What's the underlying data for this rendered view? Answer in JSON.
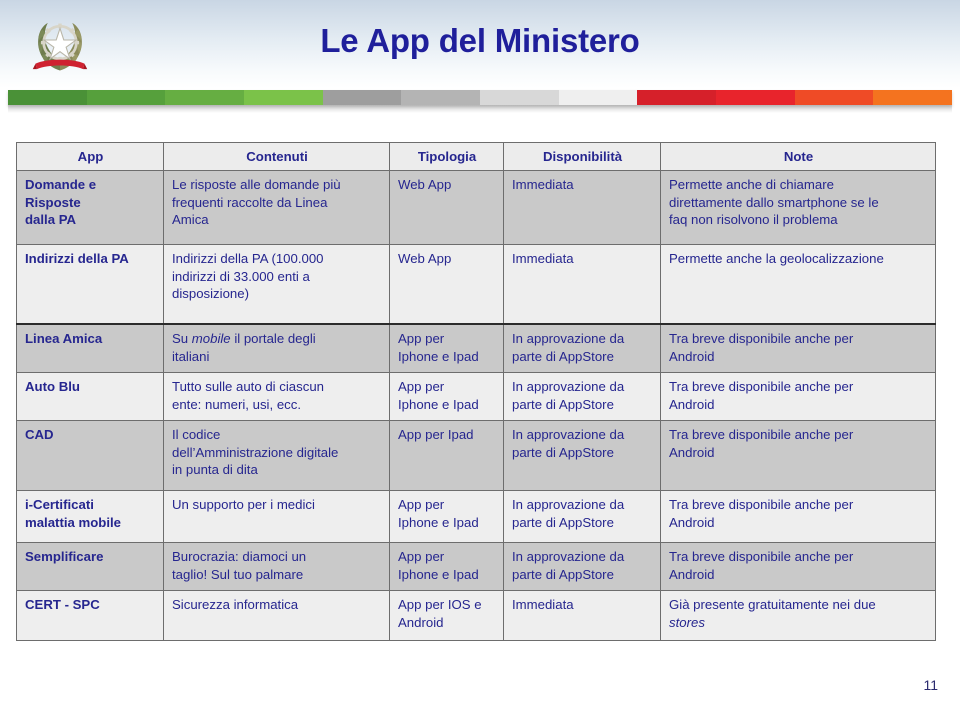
{
  "header": {
    "title": "Le App del Ministero",
    "emblem_name": "emblem-of-italy",
    "title_color": "#1f1f9b",
    "tricolor": {
      "segments": [
        "#4a9137",
        "#56a03c",
        "#66ae42",
        "#7bc249",
        "#9e9e9e",
        "#b4b4b4",
        "#d8d8d8",
        "#efefef",
        "#d6202a",
        "#e8242c",
        "#ef4b26",
        "#f4731f"
      ]
    }
  },
  "table": {
    "columns": [
      "App",
      "Contenuti",
      "Tipologia",
      "Disponibilità",
      "Note"
    ],
    "rows": [
      {
        "app": "Domande e Risposte dalla PA",
        "app_lines": [
          "Domande e",
          "Risposte",
          "dalla PA"
        ],
        "contenuti": "Le risposte alle domande più frequenti raccolte da Linea Amica",
        "contenuti_lines": [
          "Le risposte alle domande più",
          "frequenti raccolte da Linea",
          "Amica"
        ],
        "tipologia": "Web App",
        "tipologia_lines": [
          "Web App"
        ],
        "disponibilita": "Immediata",
        "disponibilita_lines": [
          "Immediata"
        ],
        "note": "Permette anche di chiamare direttamente dallo smartphone se le faq non risolvono il problema",
        "note_lines": [
          "Permette anche di chiamare",
          "direttamente dallo smartphone se le",
          "faq non risolvono il problema"
        ]
      },
      {
        "app": "Indirizzi della PA",
        "app_lines": [
          "Indirizzi della PA"
        ],
        "contenuti": "Indirizzi della PA (100.000 indirizzi di 33.000 enti a disposizione)",
        "contenuti_lines": [
          "Indirizzi della PA (100.000",
          "indirizzi di 33.000 enti a",
          "disposizione)"
        ],
        "tipologia": "Web App",
        "tipologia_lines": [
          "Web App"
        ],
        "disponibilita": "Immediata",
        "disponibilita_lines": [
          "Immediata"
        ],
        "note": "Permette anche la geolocalizzazione",
        "note_lines": [
          "Permette anche la geolocalizzazione"
        ]
      },
      {
        "app": "Linea Amica",
        "app_lines": [
          "Linea Amica"
        ],
        "contenuti": "Su mobile il portale degli italiani",
        "contenuti_lines": [
          "Su mobile il portale degli",
          "italiani"
        ],
        "contenuti_italic_word": "mobile",
        "tipologia": "App per Iphone e Ipad",
        "tipologia_lines": [
          "App per",
          "Iphone e Ipad"
        ],
        "disponibilita": "In approvazione da parte di AppStore",
        "disponibilita_lines": [
          "In approvazione da",
          "parte di AppStore"
        ],
        "note": "Tra breve disponibile anche per Android",
        "note_lines": [
          "Tra breve disponibile anche per",
          "Android"
        ]
      },
      {
        "app": "Auto Blu",
        "app_lines": [
          "Auto Blu"
        ],
        "contenuti": "Tutto sulle auto di ciascun ente: numeri, usi, ecc.",
        "contenuti_lines": [
          "Tutto sulle auto di ciascun",
          "ente: numeri, usi, ecc."
        ],
        "tipologia": "App per Iphone e Ipad",
        "tipologia_lines": [
          "App per",
          "Iphone e Ipad"
        ],
        "disponibilita": "In approvazione da parte di AppStore",
        "disponibilita_lines": [
          "In approvazione da",
          "parte di AppStore"
        ],
        "note": "Tra breve disponibile anche per Android",
        "note_lines": [
          "Tra breve disponibile anche per",
          "Android"
        ]
      },
      {
        "app": "CAD",
        "app_lines": [
          "CAD"
        ],
        "contenuti": "Il codice dell’Amministrazione digitale in punta di dita",
        "contenuti_lines": [
          "Il codice",
          "dell’Amministrazione digitale",
          "in punta di dita"
        ],
        "tipologia": "App per Ipad",
        "tipologia_lines": [
          "App per Ipad"
        ],
        "disponibilita": "In approvazione da parte di AppStore",
        "disponibilita_lines": [
          "In approvazione da",
          "parte di AppStore"
        ],
        "note": "Tra breve disponibile anche per Android",
        "note_lines": [
          "Tra breve disponibile anche per",
          "Android"
        ]
      },
      {
        "app": "i-Certificati malattia mobile",
        "app_lines": [
          "i-Certificati",
          "malattia mobile"
        ],
        "contenuti": "Un supporto per i medici",
        "contenuti_lines": [
          "Un supporto per i medici"
        ],
        "tipologia": "App per Iphone e Ipad",
        "tipologia_lines": [
          "App per",
          "Iphone e Ipad"
        ],
        "disponibilita": "In approvazione da parte di AppStore",
        "disponibilita_lines": [
          "In approvazione da",
          "parte di AppStore"
        ],
        "note": "Tra breve disponibile anche per Android",
        "note_lines": [
          "Tra breve disponibile anche per",
          "Android"
        ]
      },
      {
        "app": "Semplificare",
        "app_lines": [
          "Semplificare"
        ],
        "contenuti": "Burocrazia: diamoci un taglio! Sul tuo palmare",
        "contenuti_lines": [
          "Burocrazia: diamoci un",
          "taglio! Sul tuo palmare"
        ],
        "tipologia": "App per Iphone e Ipad",
        "tipologia_lines": [
          "App per",
          "Iphone e Ipad"
        ],
        "disponibilita": "In approvazione da parte di AppStore",
        "disponibilita_lines": [
          "In approvazione da",
          "parte di AppStore"
        ],
        "note": "Tra breve disponibile anche per Android",
        "note_lines": [
          "Tra breve disponibile anche per",
          " Android"
        ]
      },
      {
        "app": "CERT - SPC",
        "app_lines": [
          "CERT - SPC"
        ],
        "contenuti": "Sicurezza informatica",
        "contenuti_lines": [
          "Sicurezza informatica"
        ],
        "tipologia": "App per IOS e Android",
        "tipologia_lines": [
          "App per IOS e",
          "Android"
        ],
        "disponibilita": "Immediata",
        "disponibilita_lines": [
          "Immediata"
        ],
        "note": "Già presente gratuitamente nei due stores",
        "note_lines": [
          "Già presente gratuitamente nei due",
          "stores"
        ],
        "note_italic_word": "stores"
      }
    ]
  },
  "footer": {
    "page_number": "11"
  }
}
